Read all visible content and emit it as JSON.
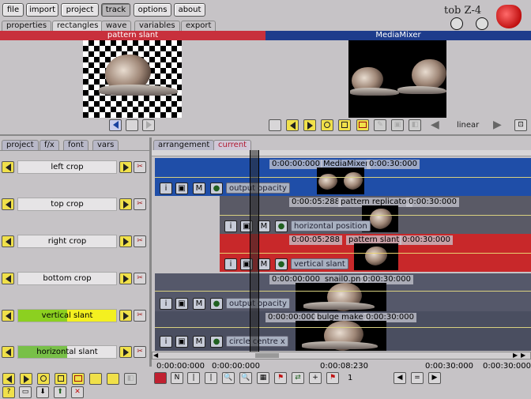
{
  "menu": {
    "file": "file",
    "import": "import",
    "project": "project",
    "track": "track",
    "options": "options",
    "about": "about"
  },
  "logo": {
    "text": "tob Z-4",
    "icon": "strawberry-logo"
  },
  "subtabs": [
    "properties",
    "rectangles",
    "wave",
    "variables",
    "export"
  ],
  "preview_left": {
    "title": "pattern slant"
  },
  "preview_right": {
    "title": "MediaMixer",
    "interp": "linear"
  },
  "panel_tabs": [
    "project",
    "f/x",
    "font",
    "vars"
  ],
  "timeline_tabs": [
    "arrangement",
    "current"
  ],
  "params": [
    {
      "label": "left crop"
    },
    {
      "label": "top crop"
    },
    {
      "label": "right crop"
    },
    {
      "label": "bottom crop"
    },
    {
      "label": "vertical slant",
      "fill": 0.5
    },
    {
      "label": "horizontal slant",
      "fill": 0.5
    }
  ],
  "tracks": [
    {
      "start": "0:00:00:000",
      "name": "MediaMixer",
      "end": "0:00:30:000",
      "param": "output opacity",
      "color": "#1f4ea8"
    },
    {
      "start": "0:00:05:288",
      "name": "pattern replicator",
      "end": "0:00:30:000",
      "param": "horizontal position",
      "color": "#5a5a66"
    },
    {
      "start": "0:00:05:288",
      "name": "pattern slant",
      "end": "0:00:30:000",
      "param": "vertical slant",
      "color": "#c8282a"
    },
    {
      "start": "0:00:00:000",
      "name": "snail0.png",
      "end": "0:00:30:000",
      "param": "output opacity",
      "color": "#55586a"
    },
    {
      "start": "0:00:00:000",
      "name": "bulge maker",
      "end": "0:00:30:000",
      "param": "circle centre x",
      "color": "#4a4e60"
    }
  ],
  "ruler": {
    "t1": "0:00:00:000",
    "t2": "0:00:00:000",
    "t3": "0:00:08:230",
    "t4": "0:00:30:000",
    "t5": "0:00:30:000"
  },
  "bottom": {
    "counter": "1"
  }
}
